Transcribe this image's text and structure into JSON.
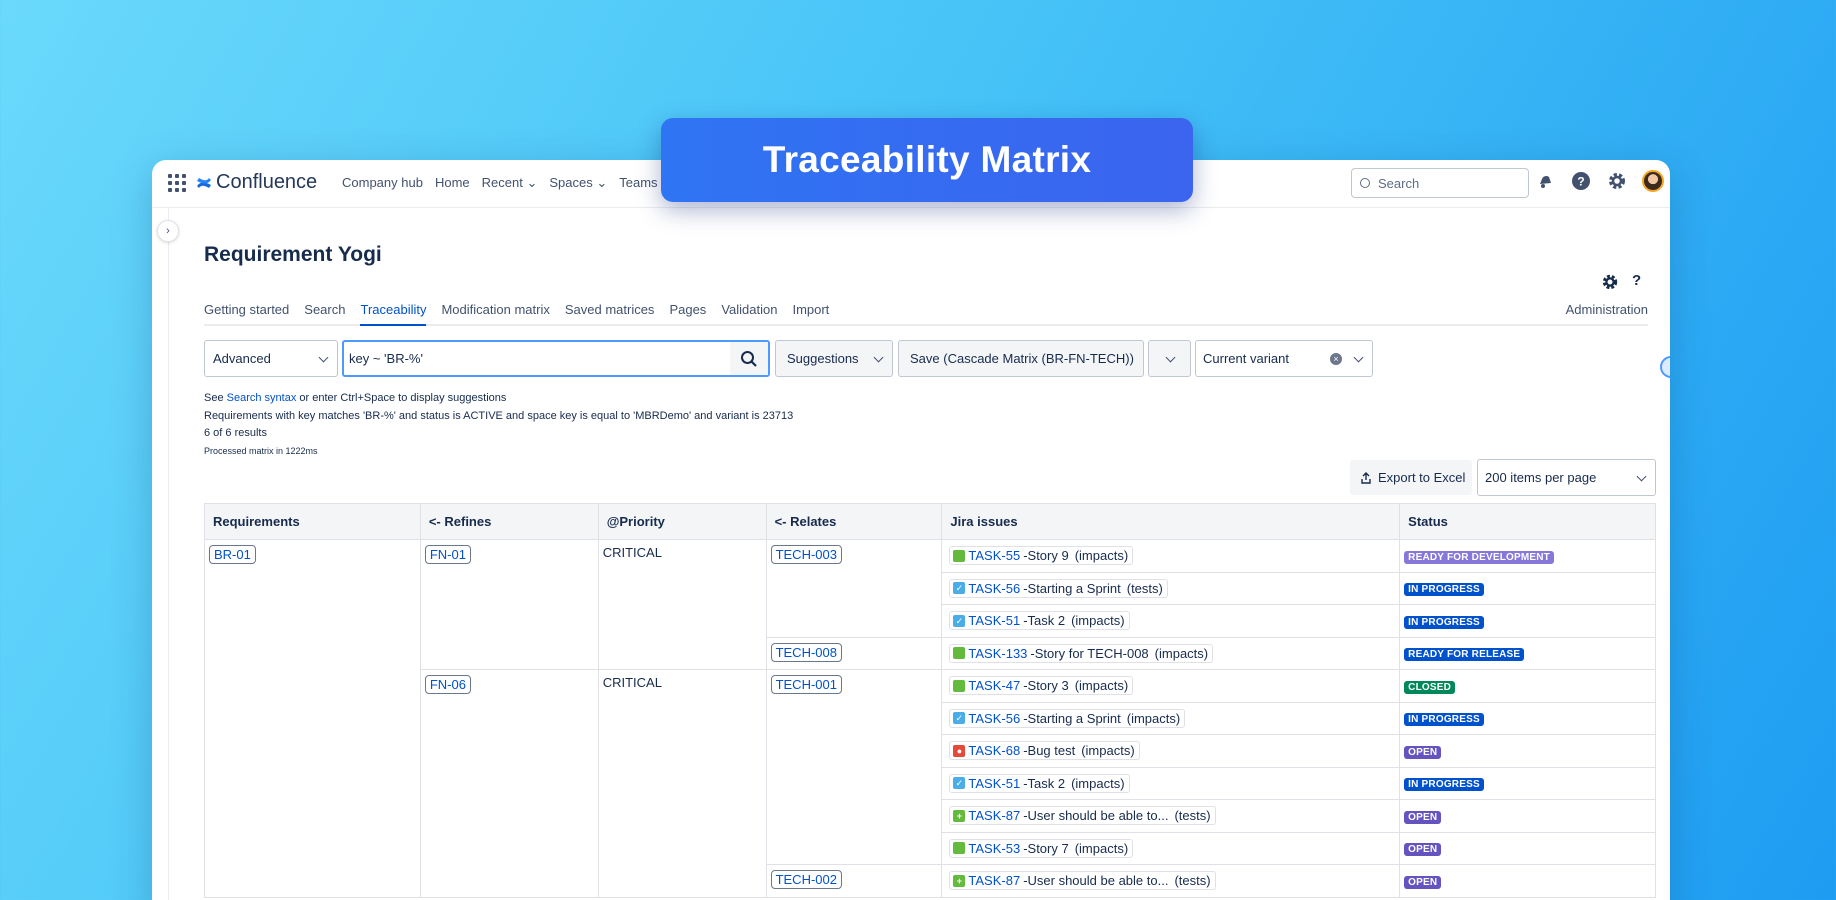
{
  "banner": {
    "title": "Traceability Matrix"
  },
  "topnav": {
    "logo": "Confluence",
    "items": [
      "Company hub",
      "Home",
      "Recent",
      "Spaces",
      "Teams"
    ],
    "search_placeholder": "Search"
  },
  "page": {
    "title": "Requirement Yogi",
    "help": "?"
  },
  "tabs": [
    "Getting started",
    "Search",
    "Traceability",
    "Modification matrix",
    "Saved matrices",
    "Pages",
    "Validation",
    "Import"
  ],
  "active_tab": "Traceability",
  "admin_link": "Administration",
  "search": {
    "mode": "Advanced",
    "query": "key ~ 'BR-%'",
    "suggestions_label": "Suggestions",
    "save_label": "Save (Cascade Matrix (BR-FN-TECH))",
    "variant": "Current variant"
  },
  "info": {
    "see": "See",
    "syntax_link": "Search syntax",
    "syntax_rest": "or enter Ctrl+Space to display suggestions",
    "description": "Requirements with key matches 'BR-%' and status is ACTIVE and space key is equal to 'MBRDemo' and variant is 23713",
    "results": "6 of 6 results",
    "processed": "Processed matrix in 1222ms"
  },
  "export_label": "Export to Excel",
  "per_page": "200 items per page",
  "columns": [
    "Requirements",
    "<- Refines",
    "@Priority",
    "<- Relates",
    "Jira issues",
    "Status"
  ],
  "status_colors": {
    "READY FOR DEVELOPMENT": "#8777d9",
    "IN PROGRESS": "#0052cc",
    "READY FOR RELEASE": "#0052cc",
    "CLOSED": "#00875a",
    "OPEN": "#6554c0"
  },
  "rows": [
    {
      "req": "BR-01",
      "refines": "FN-01",
      "priority": "CRITICAL",
      "relates": "TECH-003",
      "type": "story",
      "key": "TASK-55",
      "summary": "-Story 9",
      "rel": "(impacts)",
      "status": "READY FOR DEVELOPMENT"
    },
    {
      "type": "task",
      "key": "TASK-56",
      "summary": "-Starting a Sprint",
      "rel": "(tests)",
      "status": "IN PROGRESS"
    },
    {
      "type": "task",
      "key": "TASK-51",
      "summary": "-Task 2",
      "rel": "(impacts)",
      "status": "IN PROGRESS"
    },
    {
      "relates": "TECH-008",
      "type": "story",
      "key": "TASK-133",
      "summary": "-Story for TECH-008",
      "rel": "(impacts)",
      "status": "READY FOR RELEASE"
    },
    {
      "refines": "FN-06",
      "priority": "CRITICAL",
      "relates": "TECH-001",
      "type": "story",
      "key": "TASK-47",
      "summary": "-Story 3",
      "rel": "(impacts)",
      "status": "CLOSED"
    },
    {
      "type": "task",
      "key": "TASK-56",
      "summary": "-Starting a Sprint",
      "rel": "(impacts)",
      "status": "IN PROGRESS"
    },
    {
      "type": "bug",
      "key": "TASK-68",
      "summary": "-Bug test",
      "rel": "(impacts)",
      "status": "OPEN"
    },
    {
      "type": "task",
      "key": "TASK-51",
      "summary": "-Task 2",
      "rel": "(impacts)",
      "status": "IN PROGRESS"
    },
    {
      "type": "plus",
      "key": "TASK-87",
      "summary": "-User should be able to...",
      "rel": "(tests)",
      "status": "OPEN"
    },
    {
      "type": "story",
      "key": "TASK-53",
      "summary": "-Story 7",
      "rel": "(impacts)",
      "status": "OPEN"
    },
    {
      "relates": "TECH-002",
      "type": "plus",
      "key": "TASK-87",
      "summary": "-User should be able to...",
      "rel": "(tests)",
      "status": "OPEN"
    }
  ],
  "icons": [
    "app-switcher-icon",
    "confluence-logo-icon",
    "search-icon",
    "notification-icon",
    "help-icon",
    "settings-icon",
    "chevron-down-icon",
    "clear-icon",
    "export-icon"
  ]
}
